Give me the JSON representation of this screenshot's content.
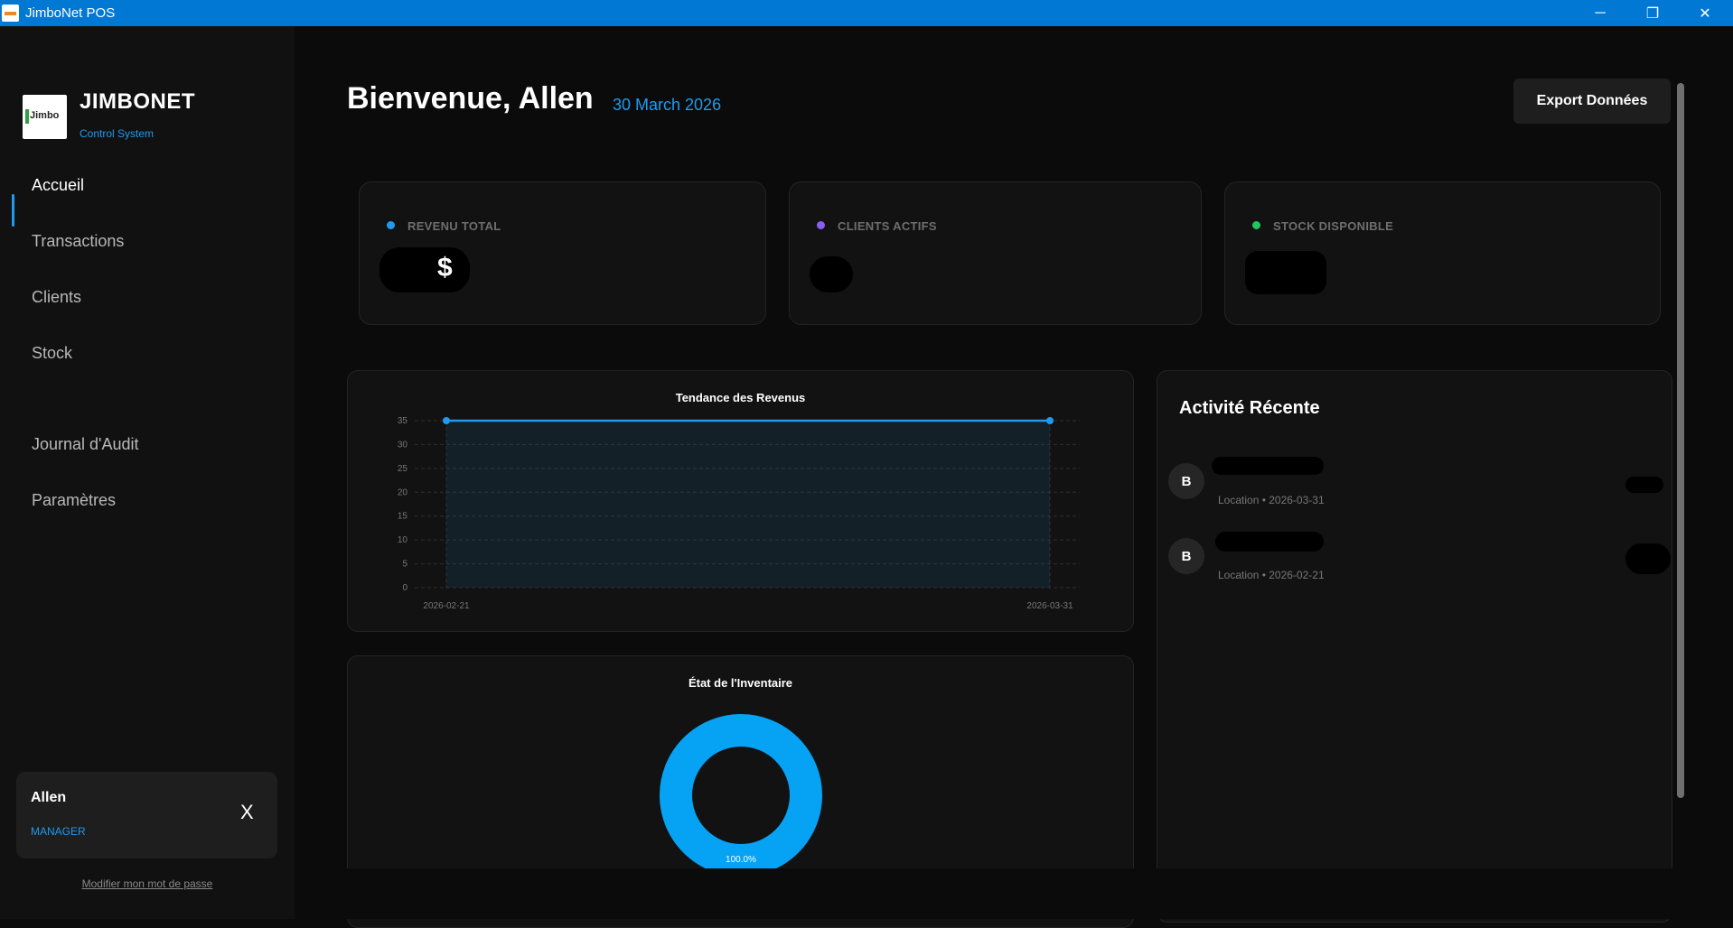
{
  "window": {
    "title": "JimboNet POS",
    "controls": {
      "minimize": "─",
      "restore": "❐",
      "close": "✕"
    }
  },
  "sidebar": {
    "logo_text": "Jimbo",
    "brand": "JIMBONET",
    "brand_sub": "Control System",
    "nav": [
      {
        "label": "Accueil",
        "active": true
      },
      {
        "label": "Transactions"
      },
      {
        "label": "Clients"
      },
      {
        "label": "Stock"
      },
      {
        "label": "Journal d'Audit"
      },
      {
        "label": "Paramètres"
      }
    ],
    "user": {
      "name": "Allen",
      "role": "MANAGER",
      "logout": "X"
    },
    "change_password": "Modifier mon mot de passe"
  },
  "header": {
    "welcome": "Bienvenue, Allen",
    "date": "30 March 2026",
    "export_button": "Export Données"
  },
  "stats": [
    {
      "label": "REVENU TOTAL",
      "value_suffix": "$",
      "dot_color": "#1e9bf0"
    },
    {
      "label": "CLIENTS ACTIFS",
      "dot_color": "#8b5cf6"
    },
    {
      "label": "STOCK DISPONIBLE",
      "dot_color": "#22c55e"
    }
  ],
  "chart_data": [
    {
      "type": "area",
      "title": "Tendance des Revenus",
      "x": [
        "2026-02-21",
        "2026-03-31"
      ],
      "series": [
        {
          "values": [
            35,
            35
          ]
        }
      ],
      "ylim": [
        0,
        35
      ],
      "yticks": [
        0,
        5,
        10,
        15,
        20,
        25,
        30,
        35
      ],
      "grid": true,
      "color": "#1e9bf0"
    },
    {
      "type": "pie",
      "title": "État de l'Inventaire",
      "slices": [
        {
          "value": 100.0,
          "label": "100.0%"
        }
      ],
      "color": "#06a3f5"
    }
  ],
  "activity": {
    "title": "Activité Récente",
    "items": [
      {
        "initial": "B",
        "subtitle": "Location • 2026-03-31"
      },
      {
        "initial": "B",
        "subtitle": "Location • 2026-02-21"
      }
    ]
  },
  "colors": {
    "accent": "#1e9bf0",
    "background": "#0b0b0b",
    "sidebar": "#111111",
    "card": "#121212"
  }
}
